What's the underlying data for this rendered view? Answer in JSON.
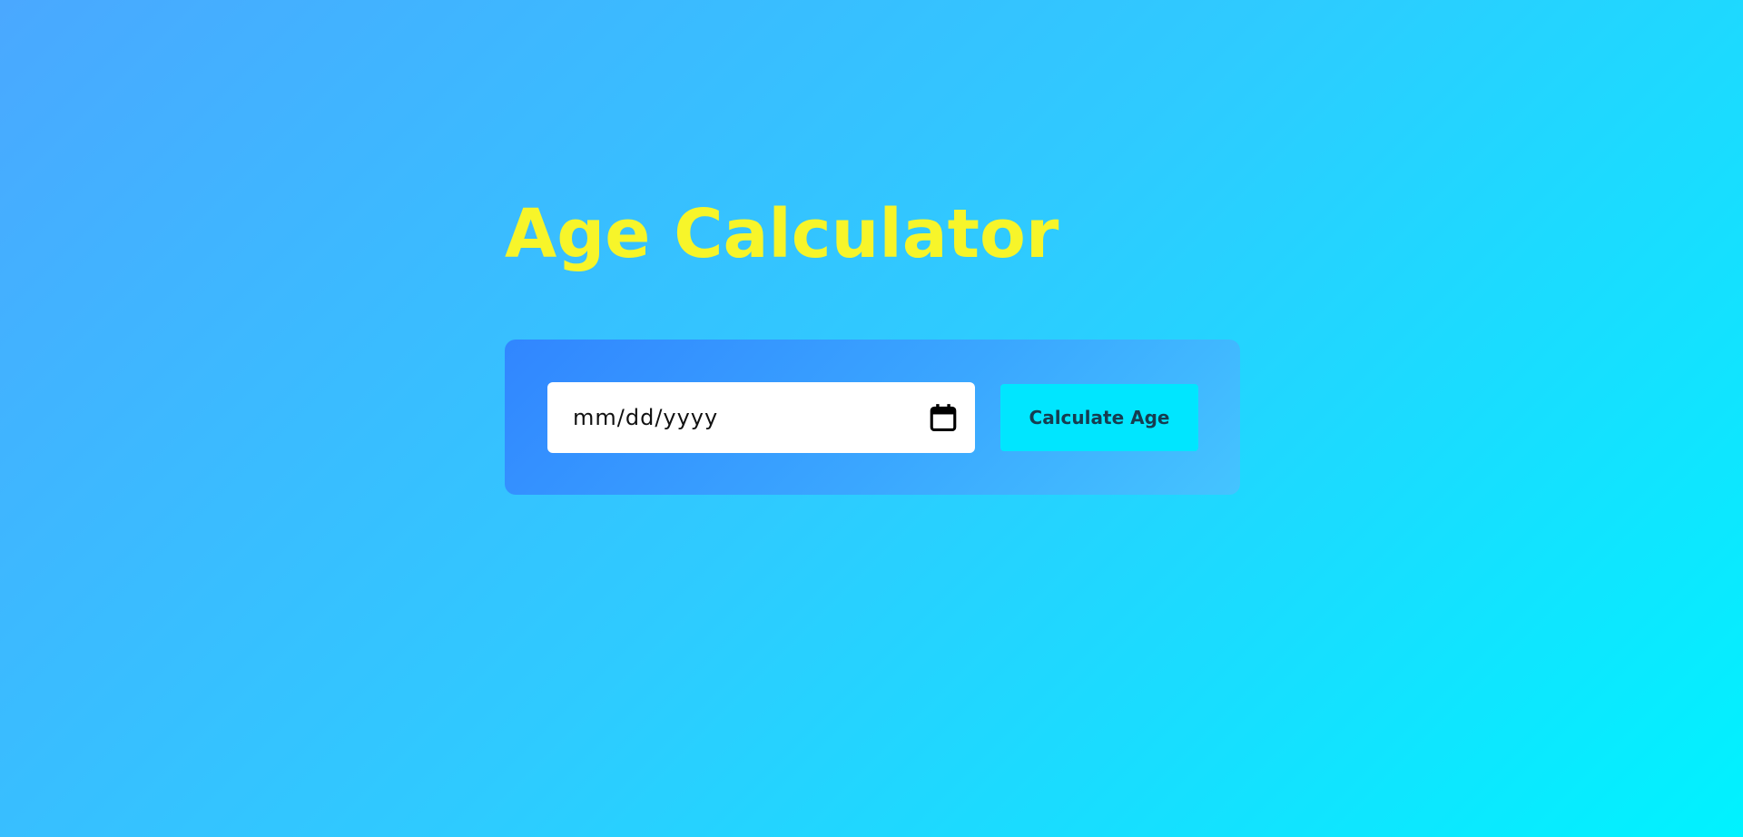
{
  "page": {
    "title": "Age Calculator"
  },
  "form": {
    "date_placeholder": "mm/dd/yyyy",
    "calendar_icon": "calendar-icon",
    "button_label": "Calculate Age"
  },
  "colors": {
    "title": "#f7f52a",
    "button_bg": "#00e6ff",
    "panel_start": "#3186ff",
    "panel_end": "#45c4ff"
  }
}
